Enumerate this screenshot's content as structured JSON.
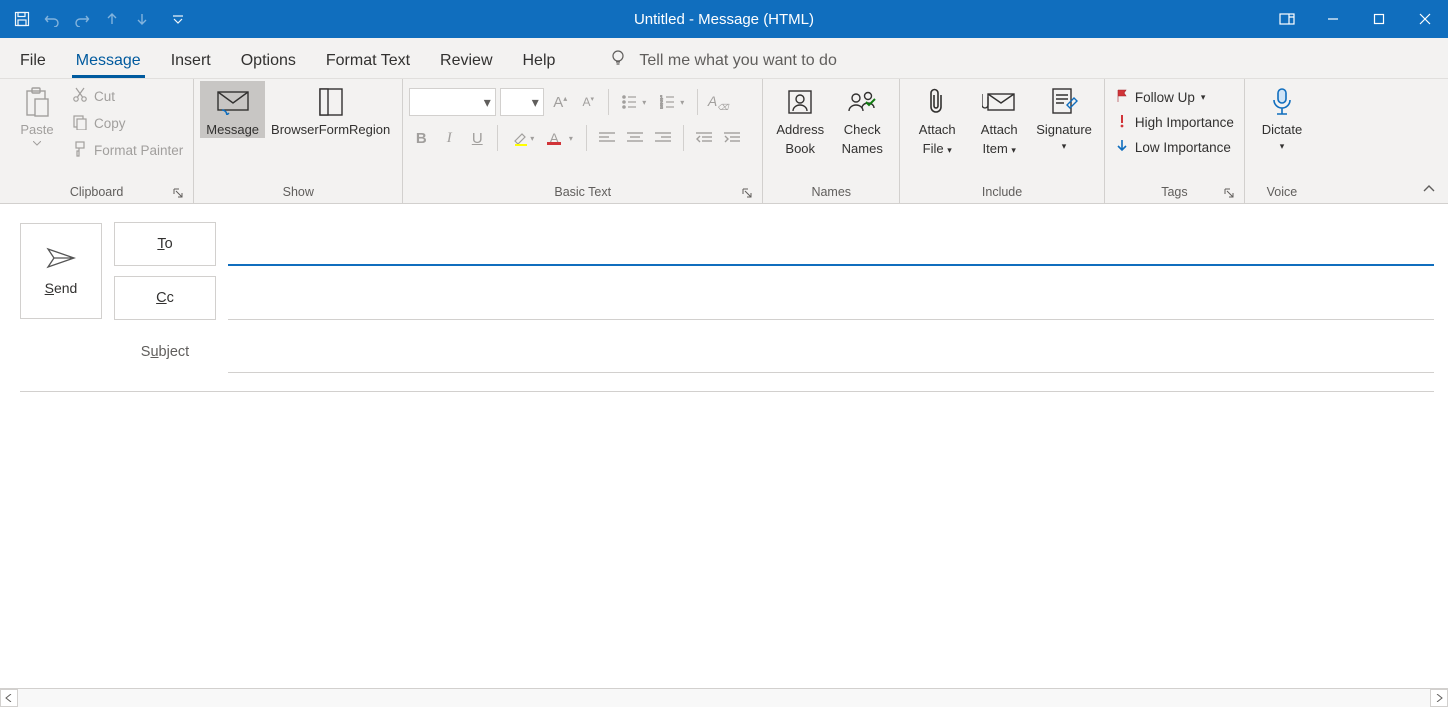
{
  "window": {
    "title": "Untitled  -  Message (HTML)"
  },
  "tabs": {
    "file": "File",
    "message": "Message",
    "insert": "Insert",
    "options": "Options",
    "format": "Format Text",
    "review": "Review",
    "help": "Help",
    "tellme": "Tell me what you want to do"
  },
  "ribbon": {
    "clipboard": {
      "label": "Clipboard",
      "paste": "Paste",
      "cut": "Cut",
      "copy": "Copy",
      "fmt": "Format Painter"
    },
    "show": {
      "label": "Show",
      "message": "Message",
      "bfr": "BrowserFormRegion"
    },
    "basictext": {
      "label": "Basic Text",
      "font_value": "",
      "size_value": ""
    },
    "names": {
      "label": "Names",
      "ab1": "Address",
      "ab2": "Book",
      "cn1": "Check",
      "cn2": "Names"
    },
    "include": {
      "label": "Include",
      "af1": "Attach",
      "af2": "File",
      "ai1": "Attach",
      "ai2": "Item",
      "sig": "Signature"
    },
    "tags": {
      "label": "Tags",
      "follow": "Follow Up",
      "high": "High Importance",
      "low": "Low Importance"
    },
    "voice": {
      "label": "Voice",
      "dictate": "Dictate"
    }
  },
  "compose": {
    "send": "Send",
    "to": "To",
    "cc": "Cc",
    "subject_label": "Subject",
    "to_value": "",
    "cc_value": "",
    "subject_value": ""
  }
}
